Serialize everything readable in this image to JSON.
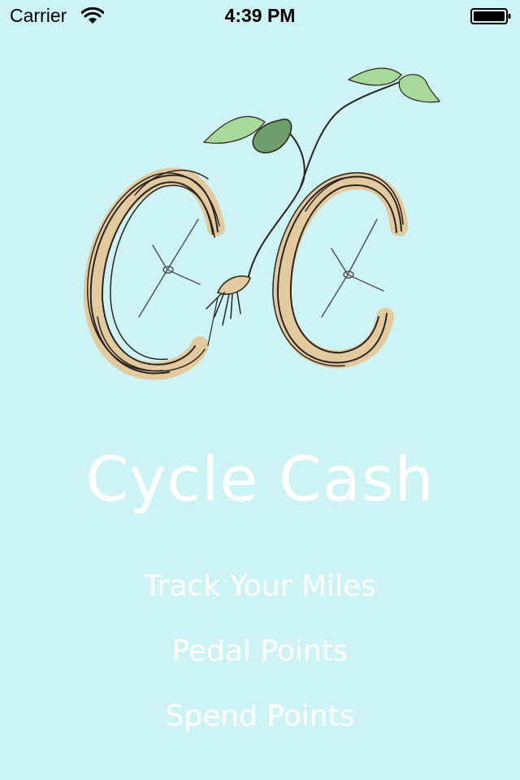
{
  "status_bar": {
    "carrier": "Carrier",
    "time": "4:39 PM",
    "wifi_icon": "wifi-icon",
    "battery_icon": "battery-full-icon"
  },
  "logo": {
    "icon": "bicycle-sprout-logo",
    "wheel_color": "#e3c99e",
    "leaf_color": "#a8d89a",
    "dark_leaf_color": "#6e9c6a"
  },
  "app_title": "Cycle Cash",
  "menu": {
    "items": [
      {
        "label": "Track Your Miles"
      },
      {
        "label": "Pedal Points"
      },
      {
        "label": "Spend Points"
      }
    ]
  },
  "colors": {
    "background": "#cdf3f5",
    "text": "#ffffff"
  }
}
